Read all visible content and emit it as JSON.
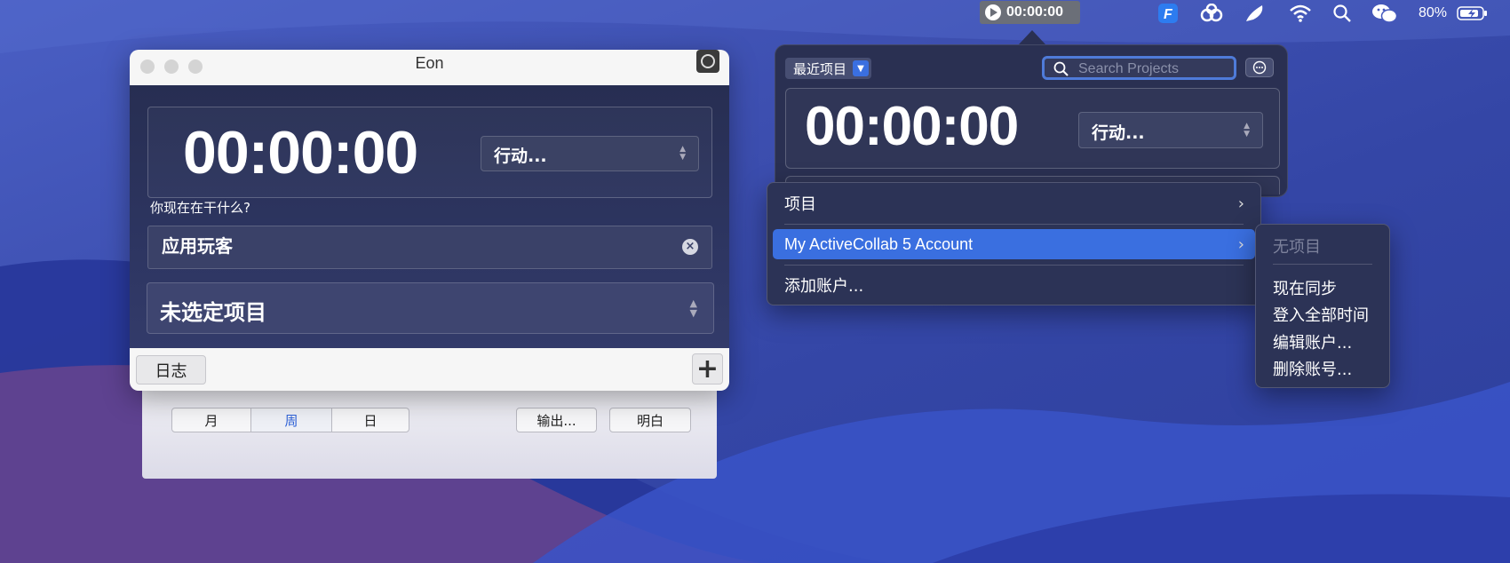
{
  "menubar": {
    "timer": "00:00:00",
    "battery": "80%",
    "icons": [
      "timer-play-icon",
      "fantastical-icon",
      "creative-cloud-icon",
      "feather-icon",
      "wifi-icon",
      "spotlight-search-icon",
      "wechat-icon",
      "battery-icon"
    ]
  },
  "eon": {
    "title": "Eon",
    "time": "00:00:00",
    "action": "行动...",
    "question": "你现在在干什么?",
    "task": "应用玩客",
    "project": "未选定项目",
    "log_button": "日志",
    "add_button": "+"
  },
  "behind": {
    "segments": [
      "月",
      "周",
      "日"
    ],
    "selected_segment": "周",
    "export": "输出...",
    "tomorrow": "明白"
  },
  "popover": {
    "recent": "最近项目",
    "search_placeholder": "Search Projects",
    "time": "00:00:00",
    "action": "行动..."
  },
  "menu": {
    "items": [
      "项目",
      "My ActiveCollab 5 Account",
      "添加账户..."
    ],
    "highlighted": "My ActiveCollab 5 Account"
  },
  "submenu": {
    "disabled": "无项目",
    "items": [
      "现在同步",
      "登入全部时间",
      "编辑账户...",
      "删除账号..."
    ]
  },
  "colors": {
    "highlight": "#3a6fe0",
    "panel": "#2c3356",
    "selected_segment_text": "#2f62d8"
  }
}
